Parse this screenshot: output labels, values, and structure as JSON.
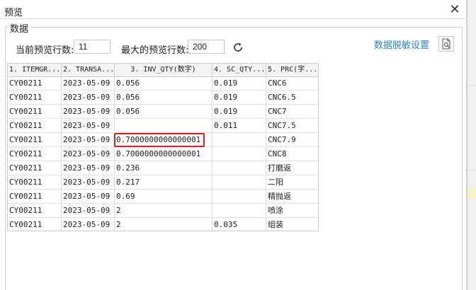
{
  "window": {
    "title": "预览",
    "close_glyph": "✕"
  },
  "group": {
    "label": "数据"
  },
  "controls": {
    "current_rows_label": "当前预览行数:",
    "current_rows_value": "11",
    "max_rows_label": "最大的预览行数:",
    "max_rows_value": "200",
    "refresh_icon": "refresh-icon",
    "mask_link": "数据脱敏设置",
    "preview_icon": "document-preview-icon"
  },
  "table": {
    "columns": [
      "1. ITEMGR...",
      "2. TRANSA...",
      "3. INV_QTY(数字)",
      "4. SC_QTY...",
      "5. PRC(字..."
    ],
    "rows": [
      [
        "CY00211",
        "2023-05-09",
        "0.056",
        "0.019",
        "CNC6"
      ],
      [
        "CY00211",
        "2023-05-09",
        "0.056",
        "0.019",
        "CNC6.5"
      ],
      [
        "CY00211",
        "2023-05-09",
        "0.056",
        "0.019",
        "CNC7"
      ],
      [
        "CY00211",
        "2023-05-09",
        "",
        "0.011",
        "CNC7.5"
      ],
      [
        "CY00211",
        "2023-05-09",
        "0.7000000000000001",
        "",
        "CNC7.9"
      ],
      [
        "CY00211",
        "2023-05-09",
        "0.7000000000000001",
        "",
        "CNC8"
      ],
      [
        "CY00211",
        "2023-05-09",
        "0.236",
        "",
        "打磨返"
      ],
      [
        "CY00211",
        "2023-05-09",
        "0.217",
        "",
        "二阳"
      ],
      [
        "CY00211",
        "2023-05-09",
        "0.69",
        "",
        "精抛返"
      ],
      [
        "CY00211",
        "2023-05-09",
        "2",
        "",
        "喷涂"
      ],
      [
        "CY00211",
        "2023-05-09",
        "2",
        "0.035",
        "组装"
      ]
    ]
  },
  "colors": {
    "accent_link": "#2f86c8",
    "highlight_border": "#e02020"
  }
}
